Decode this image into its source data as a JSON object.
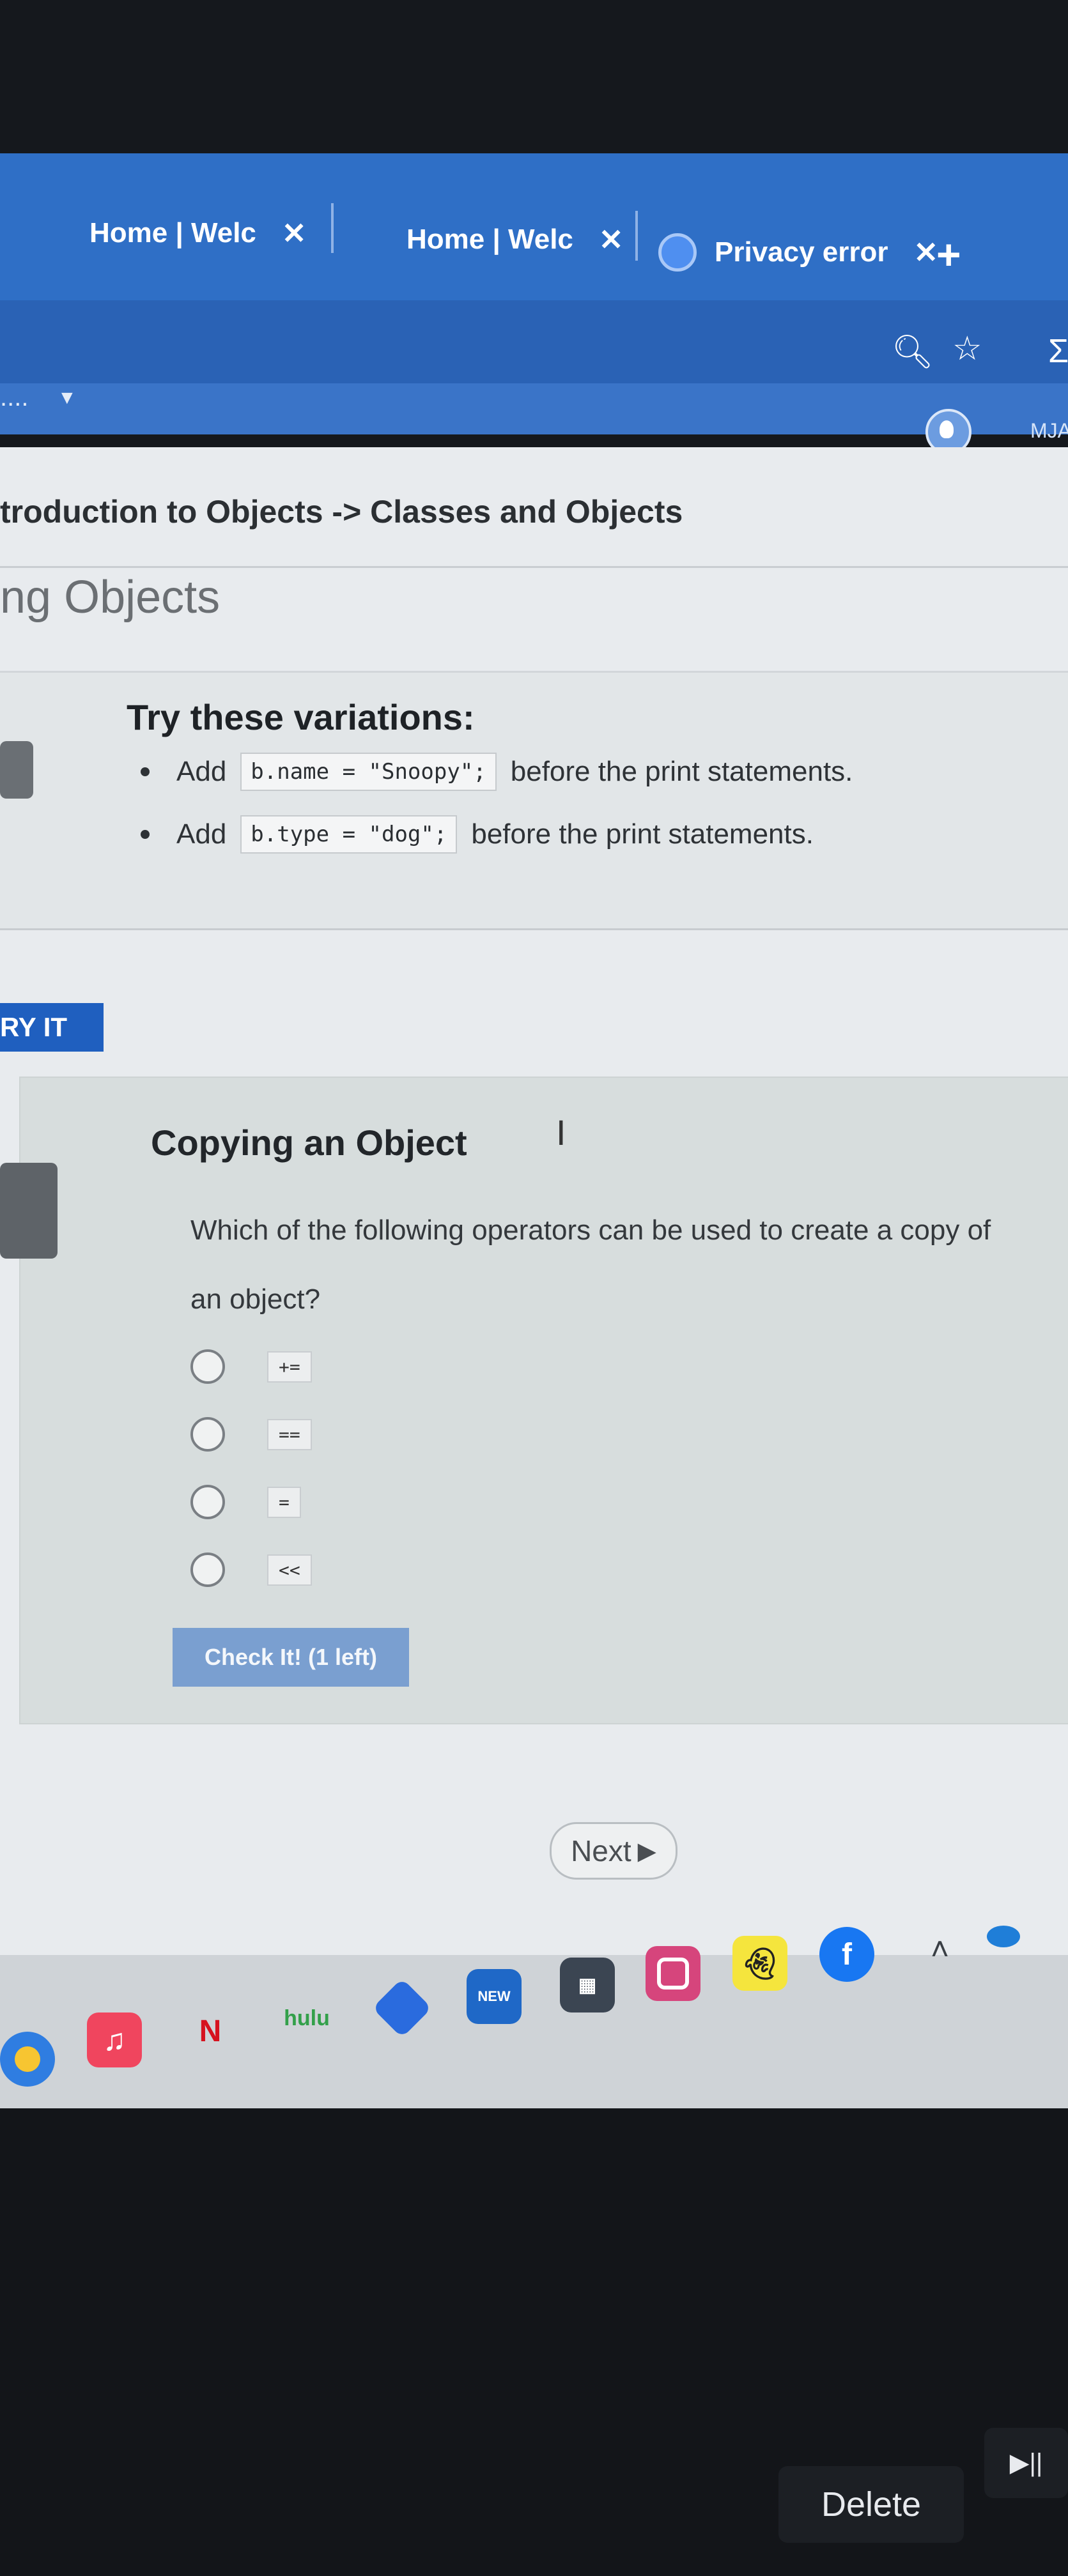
{
  "browser": {
    "tabs": [
      {
        "title": "Home | Welc",
        "close": "✕"
      },
      {
        "title": "Home | Welc",
        "close": "✕"
      },
      {
        "title": "Privacy error",
        "close": "✕"
      }
    ],
    "new_tab": "+",
    "bookmark_left": "....",
    "profile_label": "MJAI"
  },
  "page": {
    "breadcrumb": "troduction to Objects -> Classes and Objects",
    "section_title": "ng Objects",
    "variations": {
      "title": "Try these variations:",
      "items": [
        {
          "prefix": "Add",
          "code": "b.name = \"Snoopy\";",
          "suffix": "before the print statements."
        },
        {
          "prefix": "Add",
          "code": "b.type = \"dog\";",
          "suffix": "before the print statements."
        }
      ]
    },
    "try_it_label": "RY IT",
    "quiz": {
      "title": "Copying an Object",
      "question": "Which of the following operators can be used to create a copy of an object?",
      "options": [
        "+=",
        "==",
        "=",
        "<<"
      ],
      "check_label": "Check It! (1 left)"
    },
    "next_label": "Next"
  },
  "shelf": {
    "apps": [
      "chrome",
      "music",
      "netflix",
      "hulu",
      "photos",
      "outlook",
      "calculator",
      "instagram",
      "snapchat",
      "facebook"
    ],
    "hulu_label": "hulu",
    "netflix_label": "N",
    "outlook_badge": "NEW"
  },
  "keyboard": {
    "delete_label": "Delete",
    "media_label": "▶||"
  }
}
